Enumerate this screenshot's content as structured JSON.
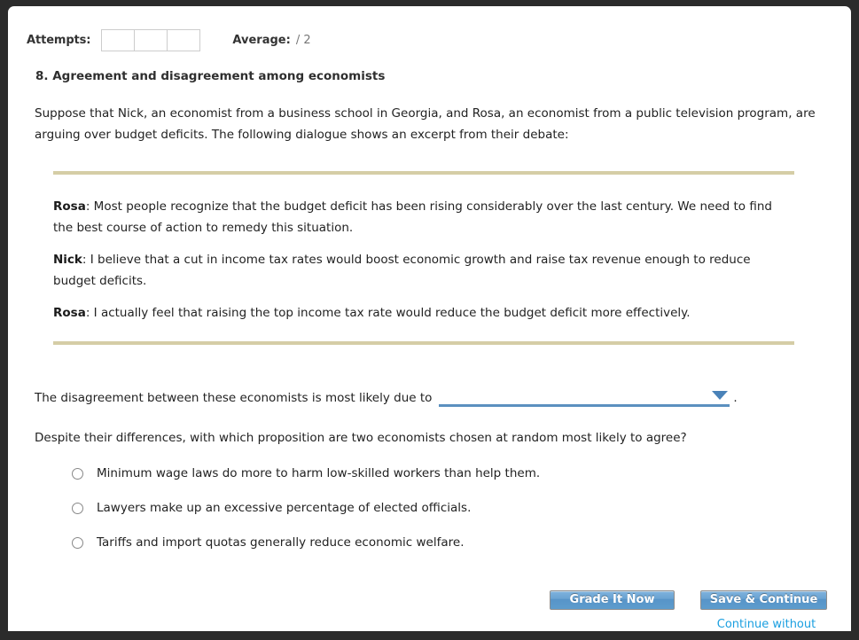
{
  "header": {
    "attempts_label": "Attempts:",
    "attempt_values": [
      "",
      "",
      ""
    ],
    "average_label": "Average:",
    "average_value": "/ 2"
  },
  "question": {
    "heading": "8. Agreement and disagreement among economists",
    "intro": "Suppose that Nick, an economist from a business school in Georgia, and Rosa, an economist from a public television program, are arguing over budget deficits. The following dialogue shows an excerpt from their debate:"
  },
  "dialogue": {
    "lines": [
      {
        "speaker": "Rosa",
        "text": ": Most people recognize that the budget deficit has been rising considerably over the last century. We need to find the best course of action to remedy this situation."
      },
      {
        "speaker": "Nick",
        "text": ": I believe that a cut in income tax rates would boost economic growth and raise tax revenue enough to reduce budget deficits."
      },
      {
        "speaker": "Rosa",
        "text": ": I actually feel that raising the top income tax rate would reduce the budget deficit more effectively."
      }
    ]
  },
  "disagreement": {
    "prefix_text": "The disagreement between these economists is most likely due to",
    "select_value": "",
    "select_placeholder": "",
    "period": ".",
    "arrow_icon": "chevron-down-icon"
  },
  "proposition": {
    "prompt": "Despite their differences, with which proposition are two economists chosen at random most likely to agree?",
    "options": [
      {
        "label": "Minimum wage laws do more to harm low-skilled workers than help them.",
        "selected": false
      },
      {
        "label": "Lawyers make up an excessive percentage of elected officials.",
        "selected": false
      },
      {
        "label": "Tariffs and import quotas generally reduce economic welfare.",
        "selected": false
      }
    ]
  },
  "footer": {
    "grade_label": "Grade It Now",
    "save_label": "Save & Continue",
    "continue_link": "Continue without saving"
  },
  "colors": {
    "accent_blue": "#5b90bf",
    "link_blue": "#1a9fe0",
    "rule_tan": "#d5cda6",
    "frame_dark": "#2b2b2b"
  }
}
